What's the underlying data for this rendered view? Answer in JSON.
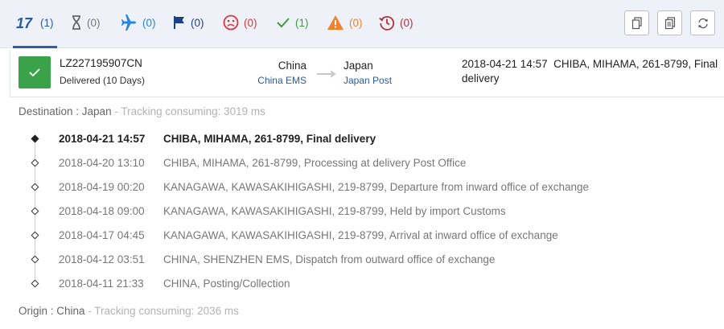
{
  "filters": [
    {
      "name": "all",
      "icon": "seventeen-track-logo-icon",
      "count": "(1)",
      "color": "#2a5aa0"
    },
    {
      "name": "pending",
      "icon": "hourglass-icon",
      "count": "(0)",
      "color": "#777777"
    },
    {
      "name": "in-transit",
      "icon": "airplane-icon",
      "count": "(0)",
      "color": "#2b86d9"
    },
    {
      "name": "pick-up",
      "icon": "flag-icon",
      "count": "(0)",
      "color": "#1e3f8a"
    },
    {
      "name": "undelivered",
      "icon": "sad-face-icon",
      "count": "(0)",
      "color": "#d9363e"
    },
    {
      "name": "delivered",
      "icon": "check-icon",
      "count": "(1)",
      "color": "#3e9b3e"
    },
    {
      "name": "alert",
      "icon": "warning-icon",
      "count": "(0)",
      "color": "#f2812c"
    },
    {
      "name": "expired",
      "icon": "history-icon",
      "count": "(0)",
      "color": "#b8303a"
    }
  ],
  "toolbar": {
    "copy_icon": "copy-icon",
    "paste_icon": "document-copy-icon",
    "refresh_icon": "refresh-icon"
  },
  "summary": {
    "tracking_number": "LZ227195907CN",
    "status": "Delivered (10 Days)",
    "origin_country": "China",
    "origin_carrier": "China EMS",
    "destination_country": "Japan",
    "destination_carrier": "Japan Post",
    "latest_event": "2018-04-21 14:57  CHIBA, MIHAMA, 261-8799, Final delivery"
  },
  "destination": {
    "label": "Destination : Japan",
    "consuming": " - Tracking consuming: 3019 ms"
  },
  "events": [
    {
      "time": "2018-04-21 14:57",
      "desc": "CHIBA, MIHAMA, 261-8799, Final delivery"
    },
    {
      "time": "2018-04-20 13:10",
      "desc": "CHIBA, MIHAMA, 261-8799, Processing at delivery Post Office"
    },
    {
      "time": "2018-04-19 00:20",
      "desc": "KANAGAWA, KAWASAKIHIGASHI, 219-8799, Departure from inward office of exchange"
    },
    {
      "time": "2018-04-18 09:00",
      "desc": "KANAGAWA, KAWASAKIHIGASHI, 219-8799, Held by import Customs"
    },
    {
      "time": "2018-04-17 04:45",
      "desc": "KANAGAWA, KAWASAKIHIGASHI, 219-8799, Arrival at inward office of exchange"
    },
    {
      "time": "2018-04-12 03:51",
      "desc": "CHINA, SHENZHEN EMS, Dispatch from outward office of exchange"
    },
    {
      "time": "2018-04-11 21:33",
      "desc": "CHINA, Posting/Collection"
    }
  ],
  "origin": {
    "label": "Origin : China",
    "consuming": " - Tracking consuming: 2036 ms"
  }
}
